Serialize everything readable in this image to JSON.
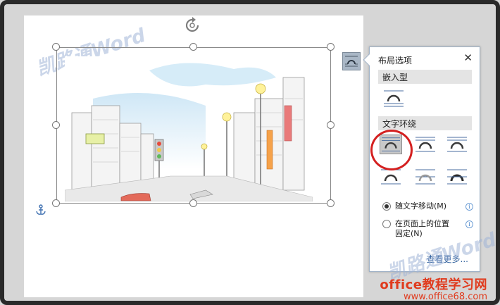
{
  "watermark": "凯路通Word",
  "panel": {
    "title": "布局选项",
    "close": "✕",
    "section_inline": "嵌入型",
    "section_wrap": "文字环绕",
    "radio_move": "随文字移动(M)",
    "radio_fixed_line1": "在页面上的位置",
    "radio_fixed_line2": "固定(N)",
    "see_more": "查看更多...",
    "info_glyph": "i"
  },
  "brand": {
    "site_name": "office教程学习网",
    "site_url": "www.office68.com"
  },
  "icons": {
    "rotate": "rotate-icon",
    "anchor": "anchor-icon",
    "layout": "layout-options-icon"
  },
  "colors": {
    "accent": "#2f5f9c",
    "highlight": "#d42020",
    "brand": "#e03b1e"
  }
}
